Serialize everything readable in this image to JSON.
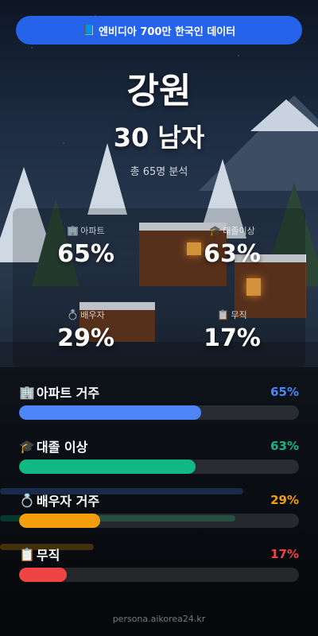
{
  "banner": {
    "icon": "book-icon",
    "text": "엔비디아 700만 한국인 데이터"
  },
  "region": "강원",
  "subtitle": "30 남자",
  "total": "총 65명 분석",
  "stats": [
    {
      "icon": "building-icon",
      "label": "아파트",
      "value": "65%"
    },
    {
      "icon": "graduation-cap-icon",
      "label": "대졸이상",
      "value": "63%"
    },
    {
      "icon": "ring-icon",
      "label": "배우자",
      "value": "29%"
    },
    {
      "icon": "clipboard-icon",
      "label": "무직",
      "value": "17%"
    }
  ],
  "bars": [
    {
      "icon": "building-icon",
      "label": "아파트 거주",
      "pct_text": "65%",
      "pct": 65,
      "color": "#4f86f7"
    },
    {
      "icon": "graduation-cap-icon",
      "label": "대졸 이상",
      "pct_text": "63%",
      "pct": 63,
      "color": "#10b981"
    },
    {
      "icon": "ring-icon",
      "label": "배우자 거주",
      "pct_text": "29%",
      "pct": 29,
      "color": "#f59e0b"
    },
    {
      "icon": "clipboard-icon",
      "label": "무직",
      "pct_text": "17%",
      "pct": 17,
      "color": "#ef4444"
    }
  ],
  "footer": "persona.aikorea24.kr"
}
